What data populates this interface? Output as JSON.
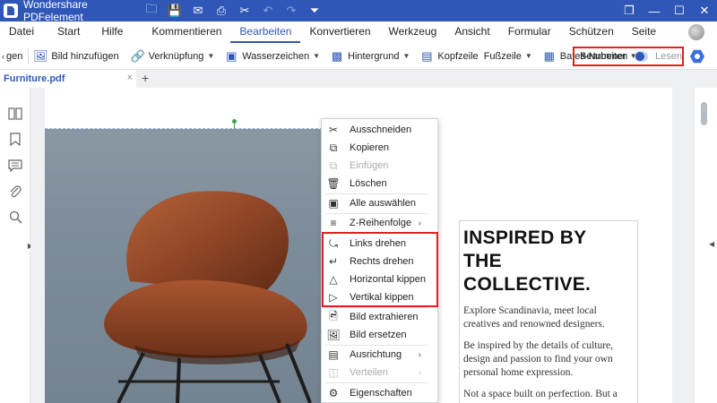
{
  "titlebar": {
    "app_title": "Wondershare PDFelement",
    "quick_access": [
      "folder-icon",
      "save-icon",
      "mail-icon",
      "print-icon",
      "scissors-icon",
      "undo-icon",
      "redo-icon",
      "dropdown-icon"
    ],
    "window_controls": [
      "minimize-icon",
      "maximize-icon",
      "close-icon"
    ]
  },
  "menubar": {
    "items": [
      "Datei",
      "Start",
      "Hilfe",
      "Kommentieren",
      "Bearbeiten",
      "Konvertieren",
      "Werkzeug",
      "Ansicht",
      "Formular",
      "Schützen",
      "Seite"
    ],
    "active": "Bearbeiten"
  },
  "toolbar": {
    "truncated_left": "gen",
    "add_image": "Bild hinzufügen",
    "link": "Verknüpfung",
    "watermark": "Wasserzeichen",
    "background": "Hintergrund",
    "header": "Kopfzeile",
    "footer": "Fußzeile",
    "bates": "Bates-Nummer",
    "mode_edit": "Bearbeiten",
    "mode_read": "Lesen"
  },
  "tabs": {
    "document": "Furniture.pdf",
    "close": "×",
    "add": "+"
  },
  "document": {
    "headline_line1": "INSPIRED BY",
    "headline_line2": "THE COLLECTIVE.",
    "para1": "Explore Scandinavia, meet local creatives and renowned designers.",
    "para2": "Be inspired by the details of culture, design and passion to find your own personal home expression.",
    "para3": "Not a space built on perfection. But a home made for living."
  },
  "context_menu": {
    "cut": "Ausschneiden",
    "copy": "Kopieren",
    "paste": "Einfügen",
    "delete": "Löschen",
    "select_all": "Alle auswählen",
    "z_order": "Z-Reihenfolge",
    "rotate_left": "Links drehen",
    "rotate_right": "Rechts drehen",
    "flip_horizontal": "Horizontal kippen",
    "flip_vertical": "Vertikal kippen",
    "extract_image": "Bild extrahieren",
    "replace_image": "Bild ersetzen",
    "alignment": "Ausrichtung",
    "distribute": "Verteilen",
    "properties": "Eigenschaften"
  },
  "colors": {
    "brand": "#2f57b8",
    "highlight_red": "#e32020",
    "selection_green": "#45a14b"
  }
}
